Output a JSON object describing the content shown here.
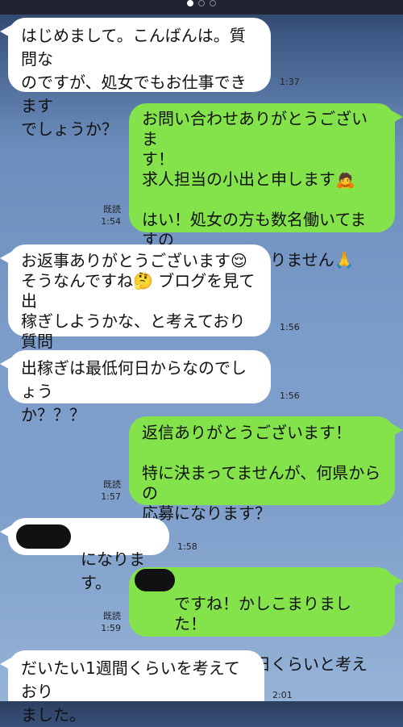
{
  "pager": {
    "active_index": 0,
    "count": 3
  },
  "messages": [
    {
      "id": "m1",
      "side": "in",
      "text": "はじめまして。こんばんは。質問な\nのですが、処女でもお仕事できます\nでしょうか？",
      "time": "1:37"
    },
    {
      "id": "m2",
      "side": "out",
      "text": "お問い合わせありがとうございま\nす！\n求人担当の小出と申します🙇\n\nはい！処女の方も数名働いてますの\nで、特に問題はありません🙏",
      "time": "1:54",
      "read": "既読"
    },
    {
      "id": "m3",
      "side": "in",
      "text": "お返事ありがとうございます😌\nそうなんですね🤔 ブログを見て出\n稼ぎしようかな、と考えており質問\nさせて頂きました。",
      "time": "1:56"
    },
    {
      "id": "m4",
      "side": "in",
      "text": "出稼ぎは最低何日からなのでしょう\nか？？？",
      "time": "1:56"
    },
    {
      "id": "m5",
      "side": "out",
      "text": "返信ありがとうございます！\n\n特に決まってませんが、何県からの\n応募になります？",
      "time": "1:57",
      "read": "既読"
    },
    {
      "id": "m6",
      "side": "in",
      "text": "になります。",
      "time": "1:58",
      "redacted": true
    },
    {
      "id": "m7",
      "side": "out",
      "text": "ですね！かしこまりました！\n\nご自身で何日くらいと考えてます？",
      "time": "1:59",
      "read": "既読",
      "redacted": true
    },
    {
      "id": "m8",
      "side": "in",
      "text": "だいたい1週間くらいを考えており\nました。",
      "time": "2:01"
    }
  ],
  "colors": {
    "incoming_bubble": "#ffffff",
    "outgoing_bubble": "#84e24a",
    "header_band": "#1f2430"
  }
}
